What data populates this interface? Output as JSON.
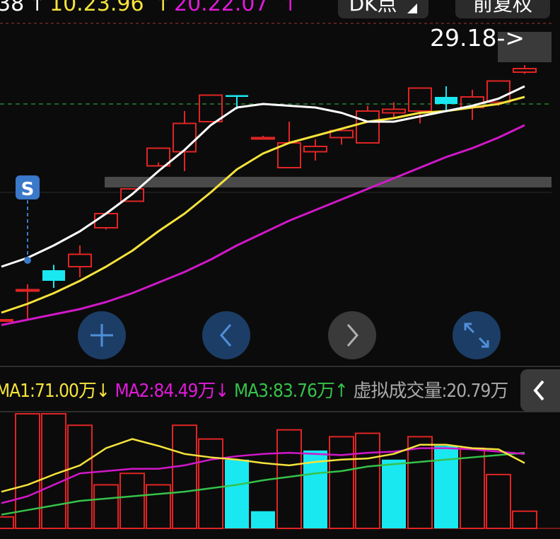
{
  "header": {
    "prev_value": "38",
    "ma_value_yellow": "10.23.96",
    "ma_value_magenta": "20.22.07",
    "arrow_up": "↑",
    "dk_label": "DK点",
    "fq_label": "前复权"
  },
  "price_label": "29.18->",
  "signal_badge": "S",
  "colors": {
    "up": "#e02424",
    "down": "#19e8f0",
    "ma_white": "#ffffff",
    "ma_yellow": "#f5e33c",
    "ma_magenta": "#d018c8",
    "vol_ma_green": "#35c24a",
    "accent_blue": "#1c3d66"
  },
  "controls": {
    "zoom_in": "plus-icon",
    "prev": "chevron-left-icon",
    "next": "chevron-right-icon",
    "fullscreen": "expand-icon"
  },
  "indicator": {
    "ma1": "MA1:71.00万↓",
    "ma2": "MA2:84.49万↓",
    "ma3": "MA3:83.76万↑",
    "virtual": "虚拟成交量:20.79万"
  },
  "chart_data": [
    {
      "type": "candlestick",
      "title": "",
      "candles": [
        {
          "o": 27.78,
          "c": 27.78,
          "h": 27.78,
          "l": 27.78
        },
        {
          "o": 27.95,
          "c": 27.95,
          "h": 27.98,
          "l": 27.78
        },
        {
          "o": 28.06,
          "c": 28.0,
          "h": 28.09,
          "l": 27.96
        },
        {
          "o": 28.08,
          "c": 28.15,
          "h": 28.2,
          "l": 28.02
        },
        {
          "o": 28.3,
          "c": 28.38,
          "h": 28.38,
          "l": 28.29
        },
        {
          "o": 28.45,
          "c": 28.52,
          "h": 28.52,
          "l": 28.45
        },
        {
          "o": 28.65,
          "c": 28.75,
          "h": 28.75,
          "l": 28.67
        },
        {
          "o": 28.73,
          "c": 28.89,
          "h": 28.96,
          "l": 28.62
        },
        {
          "o": 28.9,
          "c": 29.05,
          "h": 29.05,
          "l": 28.9
        },
        {
          "o": 29.05,
          "c": 29.04,
          "h": 29.05,
          "l": 28.97
        },
        {
          "o": 28.81,
          "c": 28.81,
          "h": 28.82,
          "l": 28.81
        },
        {
          "o": 28.64,
          "c": 28.78,
          "h": 28.9,
          "l": 28.64
        },
        {
          "o": 28.73,
          "c": 28.76,
          "h": 28.8,
          "l": 28.68
        },
        {
          "o": 28.81,
          "c": 28.85,
          "h": 28.86,
          "l": 28.77
        },
        {
          "o": 28.78,
          "c": 28.96,
          "h": 28.99,
          "l": 28.78
        },
        {
          "o": 28.95,
          "c": 28.97,
          "h": 29.01,
          "l": 28.92
        },
        {
          "o": 28.96,
          "c": 29.09,
          "h": 29.09,
          "l": 28.89
        },
        {
          "o": 29.04,
          "c": 29.0,
          "h": 29.1,
          "l": 28.96
        },
        {
          "o": 28.98,
          "c": 29.04,
          "h": 29.08,
          "l": 28.91
        },
        {
          "o": 29.01,
          "c": 29.13,
          "h": 29.13,
          "l": 28.99
        },
        {
          "o": 29.18,
          "c": 29.2,
          "h": 29.22,
          "l": 29.17
        }
      ],
      "ma_white": [
        28.08,
        28.13,
        28.2,
        28.28,
        28.38,
        28.49,
        28.62,
        28.74,
        28.88,
        28.98,
        29.0,
        28.99,
        28.98,
        28.95,
        28.9,
        28.9,
        28.93,
        28.96,
        28.99,
        29.03,
        29.1
      ],
      "ma_yellow": [
        27.82,
        27.87,
        27.93,
        28.0,
        28.08,
        28.17,
        28.28,
        28.38,
        28.5,
        28.63,
        28.72,
        28.78,
        28.82,
        28.86,
        28.9,
        28.92,
        28.95,
        28.96,
        28.98,
        29.0,
        29.04
      ],
      "ma_magenta": [
        27.75,
        27.78,
        27.81,
        27.84,
        27.88,
        27.93,
        27.99,
        28.05,
        28.12,
        28.2,
        28.27,
        28.34,
        28.4,
        28.46,
        28.52,
        28.58,
        28.64,
        28.7,
        28.75,
        28.81,
        28.88
      ],
      "signal": {
        "index": 1,
        "label": "S"
      }
    },
    {
      "type": "bar",
      "title": "",
      "unit": "万",
      "values": [
        10,
        100,
        100,
        90,
        38,
        48,
        38,
        90,
        78,
        60,
        15,
        86,
        68,
        80,
        83,
        60,
        80,
        72,
        70,
        47,
        15
      ],
      "up": [
        true,
        true,
        true,
        true,
        true,
        true,
        true,
        true,
        true,
        false,
        false,
        true,
        false,
        true,
        true,
        false,
        true,
        false,
        true,
        true,
        true
      ],
      "ma_yellow": [
        32,
        38,
        47,
        55,
        70,
        78,
        72,
        65,
        62,
        60,
        57,
        55,
        58,
        60,
        61,
        65,
        73,
        73,
        70,
        69,
        57
      ],
      "ma_magenta": [
        22,
        28,
        38,
        48,
        50,
        52,
        52,
        55,
        60,
        63,
        65,
        66,
        65,
        64,
        66,
        67,
        70,
        70,
        69,
        67,
        65
      ],
      "ma_green": [
        12,
        16,
        20,
        24,
        26,
        28,
        30,
        32,
        35,
        38,
        42,
        45,
        48,
        50,
        54,
        56,
        58,
        60,
        62,
        64,
        66
      ],
      "ylim": [
        0,
        100
      ]
    }
  ]
}
